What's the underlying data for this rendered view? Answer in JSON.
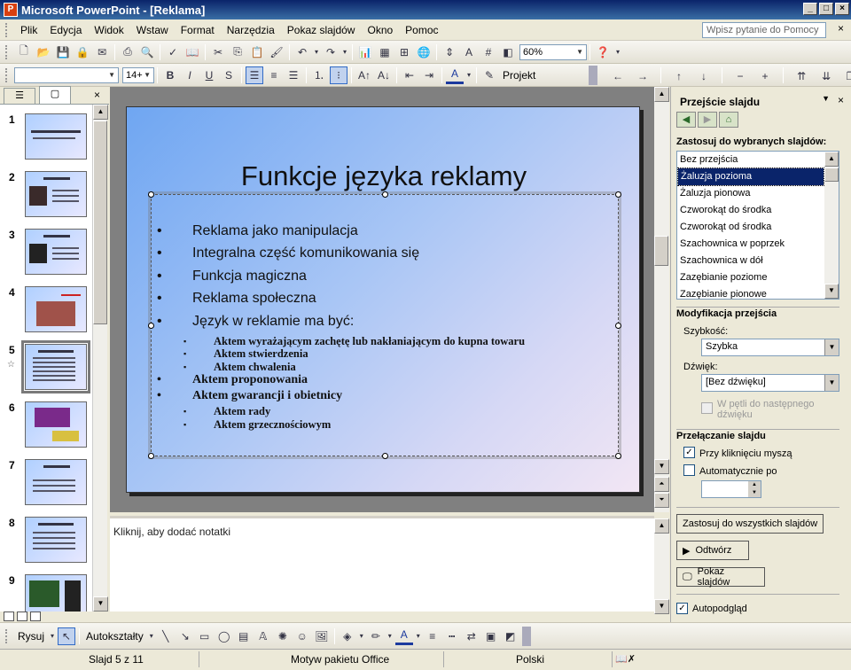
{
  "window": {
    "title": "Microsoft PowerPoint - [Reklama]",
    "min": "_",
    "max": "□",
    "close": "×"
  },
  "menu": {
    "items": [
      "Plik",
      "Edycja",
      "Widok",
      "Wstaw",
      "Format",
      "Narzędzia",
      "Pokaz slajdów",
      "Okno",
      "Pomoc"
    ],
    "help_placeholder": "Wpisz pytanie do Pomocy",
    "close": "×"
  },
  "toolbar_std": {
    "zoom": "60%"
  },
  "toolbar_fmt": {
    "font_size": "14+",
    "design_label": "Projekt"
  },
  "left_panel": {
    "tab_outline": "☰",
    "tab_slides": "▢",
    "close": "×",
    "slide_numbers": [
      "1",
      "2",
      "3",
      "4",
      "5",
      "6",
      "7",
      "8",
      "9"
    ],
    "selected_slide": 5
  },
  "slide": {
    "title": "Funkcje języka reklamy",
    "bullets_l1": [
      "Reklama jako manipulacja",
      "Integralna część komunikowania się",
      "Funkcja magiczna",
      "Reklama społeczna",
      "Język w reklamie ma być:"
    ],
    "bullets_sub1": [
      "Aktem wyrażającym zachętę lub nakłaniającym do kupna towaru",
      "Aktem stwierdzenia",
      "Aktem chwalenia"
    ],
    "bullets_l1b": [
      "Aktem proponowania",
      "Aktem gwarancji i obietnicy"
    ],
    "bullets_sub2": [
      "Aktem rady",
      "Aktem grzecznościowym"
    ],
    "bullet_char": "•",
    "sub_bullet_char": "▪"
  },
  "notes": {
    "placeholder": "Kliknij, aby dodać notatki"
  },
  "taskpane": {
    "title": "Przejście slajdu",
    "close": "×",
    "apply_label": "Zastosuj do wybranych slajdów:",
    "transitions": [
      "Bez przejścia",
      "Żaluzja pozioma",
      "Żaluzja pionowa",
      "Czworokąt do środka",
      "Czworokąt od środka",
      "Szachownica w poprzek",
      "Szachownica w dół",
      "Zazębianie poziome",
      "Zazębianie pionowe"
    ],
    "selected_transition": 1,
    "modify_label": "Modyfikacja przejścia",
    "speed_label": "Szybkość:",
    "speed_value": "Szybka",
    "sound_label": "Dźwięk:",
    "sound_value": "[Bez dźwięku]",
    "loop_label_1": "W pętli do następnego",
    "loop_label_2": "dźwięku",
    "advance_label": "Przełączanie slajdu",
    "on_click_label": "Przy kliknięciu myszą",
    "auto_label": "Automatycznie po",
    "apply_all_button": "Zastosuj do wszystkich slajdów",
    "play_button": "Odtwórz",
    "slideshow_button": "Pokaz slajdów",
    "autopreview_label": "Autopodgląd"
  },
  "drawbar": {
    "draw_label": "Rysuj",
    "autoshapes_label": "Autokształty"
  },
  "status": {
    "slide_pos": "Slajd 5 z 11",
    "design": "Motyw pakietu Office",
    "language": "Polski"
  }
}
